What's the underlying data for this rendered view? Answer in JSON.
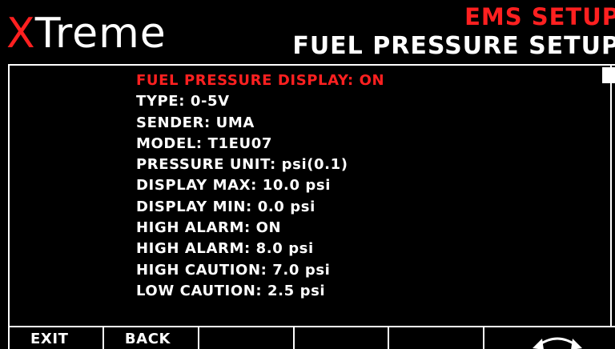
{
  "header": {
    "logo_accent": "X",
    "logo_rest": "Treme",
    "title_primary": "EMS SETUP",
    "title_secondary": "FUEL PRESSURE SETUP"
  },
  "menu": {
    "items": [
      {
        "label": "FUEL PRESSURE DISPLAY: ON",
        "selected": true
      },
      {
        "label": "TYPE: 0-5V"
      },
      {
        "label": "SENDER: UMA"
      },
      {
        "label": "MODEL: T1EU07"
      },
      {
        "label": "PRESSURE UNIT: psi(0.1)"
      },
      {
        "label": "DISPLAY MAX: 10.0 psi"
      },
      {
        "label": "DISPLAY MIN: 0.0 psi"
      },
      {
        "label": "HIGH ALARM: ON"
      },
      {
        "label": "HIGH ALARM: 8.0 psi"
      },
      {
        "label": "HIGH CAUTION: 7.0 psi"
      },
      {
        "label": "LOW CAUTION: 2.5 psi"
      }
    ]
  },
  "softkeys": {
    "exit_label": "EXIT",
    "back_label": "BACK",
    "key3_label": "",
    "key4_label": "",
    "key5_label": "",
    "rotary_icon": "rotary-knob-icon"
  },
  "colors": {
    "background": "#000000",
    "text": "#ffffff",
    "accent": "#ff2020"
  }
}
